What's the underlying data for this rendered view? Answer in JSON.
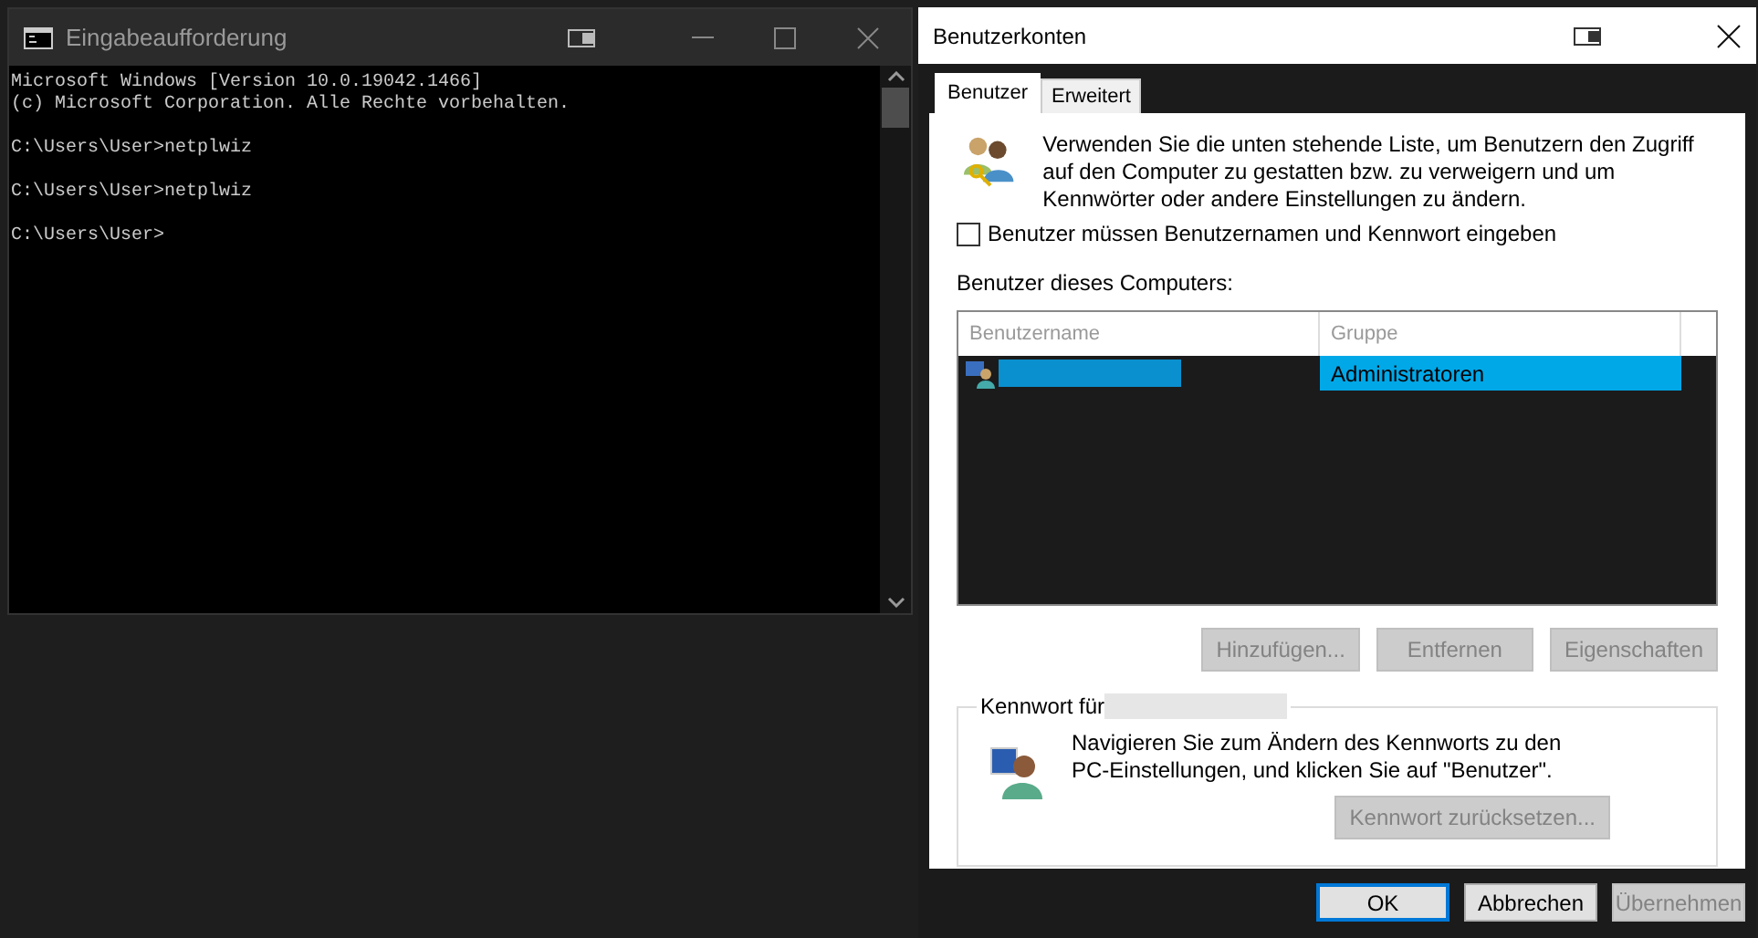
{
  "console_window": {
    "title": "Eingabeaufforderung",
    "output_blocks": [
      [
        "Microsoft Windows [Version 10.0.19042.1466]",
        "(c) Microsoft Corporation. Alle Rechte vorbehalten."
      ],
      [
        "C:\\Users\\User>netplwiz"
      ],
      [
        "C:\\Users\\User>netplwiz"
      ],
      [
        "C:\\Users\\User>"
      ]
    ]
  },
  "dialog": {
    "title": "Benutzerkonten",
    "tabs": [
      {
        "label": "Benutzer",
        "selected": true
      },
      {
        "label": "Erweitert",
        "selected": false
      }
    ],
    "intro": "Verwenden Sie die unten stehende Liste, um Benutzern den Zugriff auf den Computer zu gestatten bzw. zu verweigern und um Kennwörter oder andere Einstellungen zu ändern.",
    "require_login": {
      "label": "Benutzer müssen Benutzernamen und Kennwort eingeben",
      "checked": false
    },
    "users_label": "Benutzer dieses Computers:",
    "table": {
      "columns": [
        "Benutzername",
        "Gruppe"
      ],
      "rows": [
        {
          "group": "Administratoren",
          "selected": true
        }
      ]
    },
    "list_buttons": [
      {
        "label": "Hinzufügen...",
        "disabled": true
      },
      {
        "label": "Entfernen",
        "disabled": true
      },
      {
        "label": "Eigenschaften",
        "disabled": true
      }
    ],
    "password_group": {
      "title": "Kennwort für",
      "text": "Navigieren Sie zum Ändern des Kennworts zu den PC-Einstellungen, und klicken Sie auf \"Benutzer\".",
      "button": {
        "label": "Kennwort zurücksetzen...",
        "disabled": true
      }
    },
    "footer_buttons": [
      {
        "label": "OK",
        "disabled": false,
        "default": true
      },
      {
        "label": "Abbrechen",
        "disabled": false,
        "default": false
      },
      {
        "label": "Übernehmen",
        "disabled": true,
        "default": false
      }
    ]
  }
}
